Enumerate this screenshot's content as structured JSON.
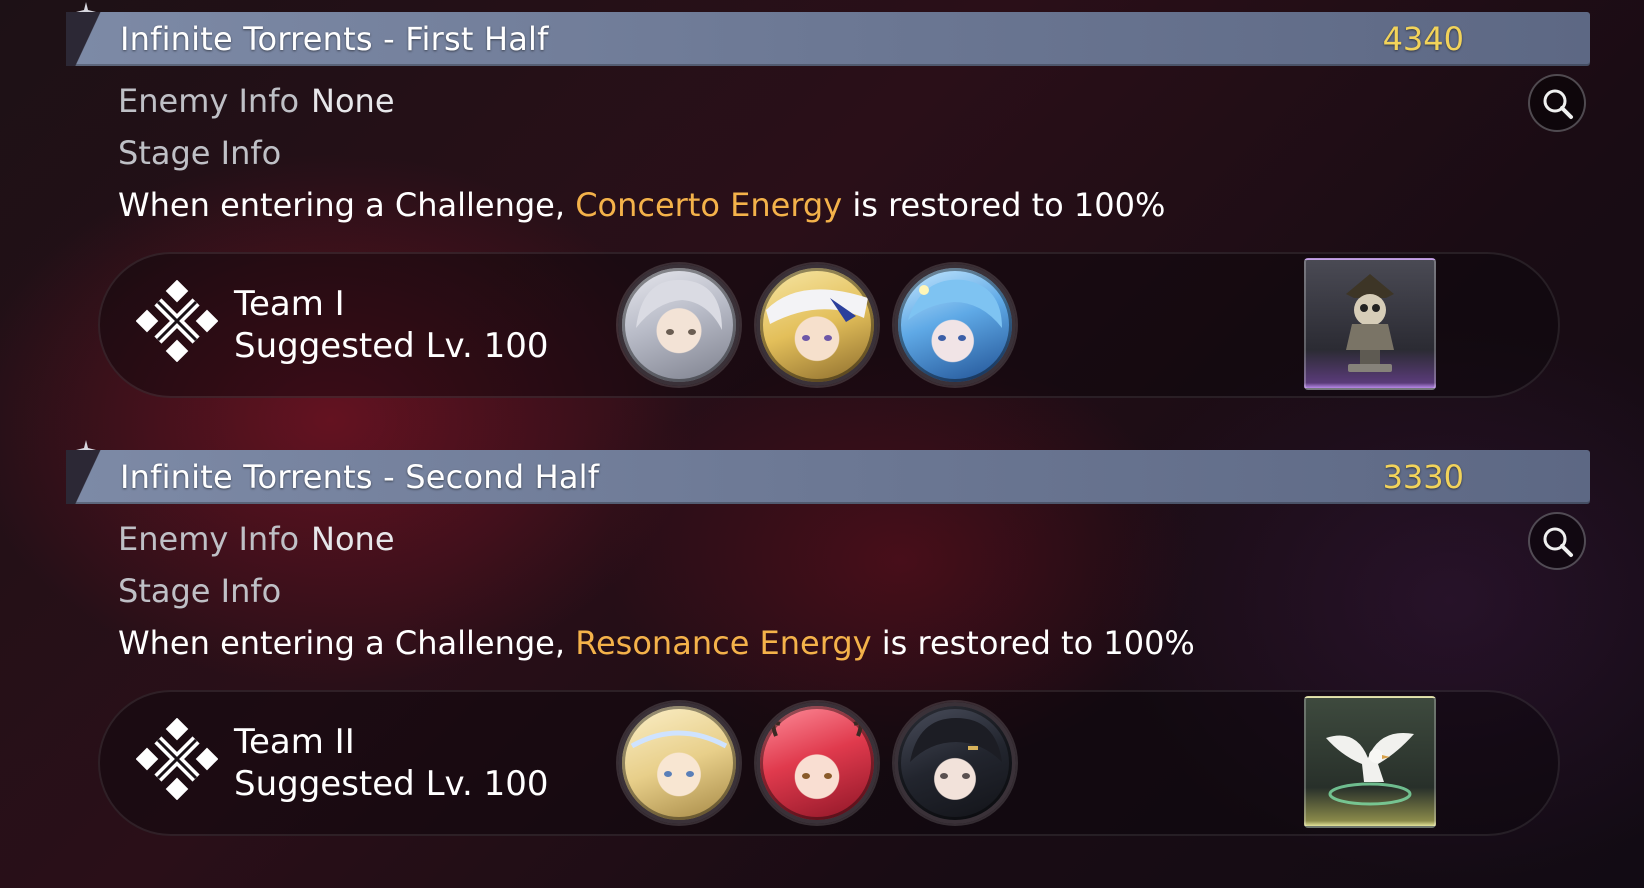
{
  "sections": [
    {
      "title": "Infinite Torrents - First Half",
      "score": "4340",
      "enemy_label": "Enemy Info",
      "enemy_value": "None",
      "stage_label": "Stage Info",
      "desc_prefix": "When entering a Challenge, ",
      "desc_highlight": "Concerto Energy",
      "desc_suffix": " is restored to 100%",
      "team_name": "Team I",
      "team_level": "Suggested Lv. 100",
      "search_icon": "magnifier-icon",
      "avatars": [
        "silver-haired-character",
        "blonde-white-hat-character",
        "blue-haired-character"
      ],
      "echo": "skull-pirate-bust-echo"
    },
    {
      "title": "Infinite Torrents - Second Half",
      "score": "3330",
      "enemy_label": "Enemy Info",
      "enemy_value": "None",
      "stage_label": "Stage Info",
      "desc_prefix": "When entering a Challenge, ",
      "desc_highlight": "Resonance Energy",
      "desc_suffix": " is restored to 100%",
      "team_name": "Team II",
      "team_level": "Suggested Lv. 100",
      "search_icon": "magnifier-icon",
      "avatars": [
        "blonde-laurel-crown-character",
        "red-haired-antlered-character",
        "dark-haired-character"
      ],
      "echo": "white-dove-echo"
    }
  ],
  "colors": {
    "header_bar": "#7d8aa6",
    "score": "#f2d35a",
    "highlight": "#f4b24a",
    "label_gray": "#bfc0c6"
  }
}
